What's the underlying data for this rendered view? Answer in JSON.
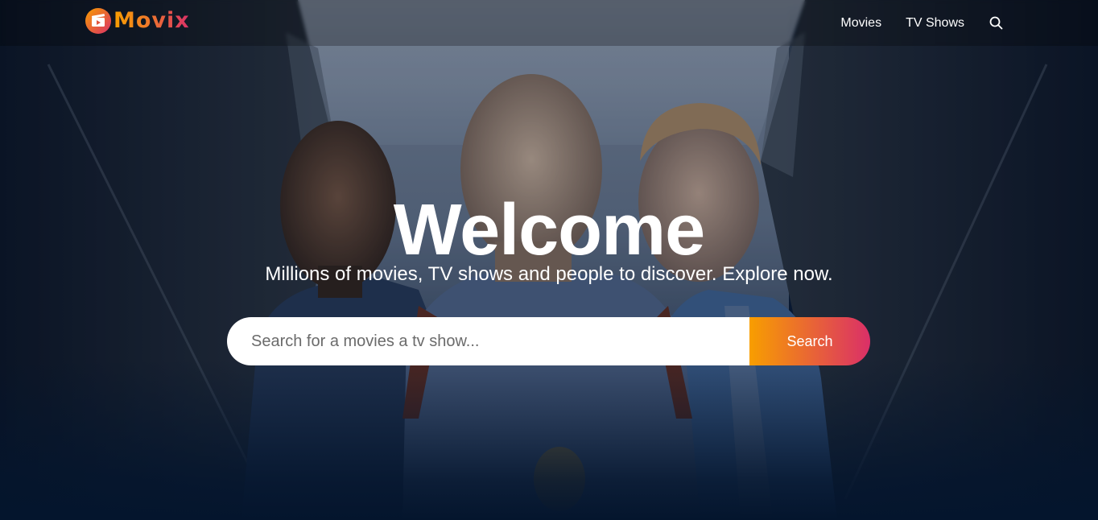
{
  "app": {
    "logo_text": "Movix",
    "logo_icon": "film-ticket-icon"
  },
  "header": {
    "nav": [
      {
        "label": "Movies"
      },
      {
        "label": "TV Shows"
      }
    ],
    "search_icon": "search-icon"
  },
  "hero": {
    "title": "Welcome",
    "subtitle": "Millions of movies, TV shows and people to discover. Explore now.",
    "search": {
      "placeholder": "Search for a movies a tv show...",
      "value": "",
      "button_label": "Search"
    }
  },
  "colors": {
    "background": "#04152d",
    "gradient_start": "#f89e00",
    "gradient_end": "#da2f68",
    "text": "#ffffff"
  }
}
